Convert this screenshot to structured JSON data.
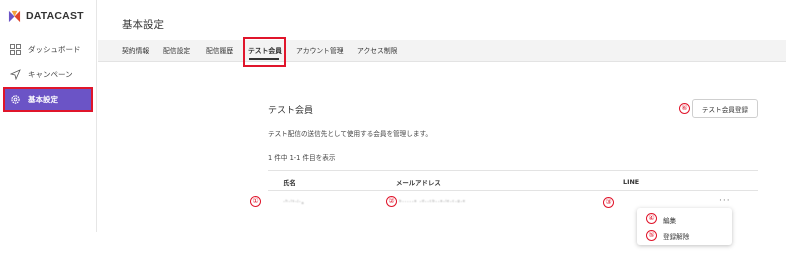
{
  "app": {
    "logo_text": "DATACAST"
  },
  "sidebar": {
    "items": [
      {
        "label": "ダッシュボード",
        "icon": "dashboard-icon"
      },
      {
        "label": "キャンペーン",
        "icon": "send-icon"
      },
      {
        "label": "基本設定",
        "icon": "gear-icon",
        "active": true
      }
    ]
  },
  "header": {
    "title": "基本設定"
  },
  "tabs": [
    {
      "label": "契約情報"
    },
    {
      "label": "配信設定"
    },
    {
      "label": "配信履歴"
    },
    {
      "label": "テスト会員",
      "active": true
    },
    {
      "label": "アカウント管理"
    },
    {
      "label": "アクセス制限"
    }
  ],
  "main": {
    "section_title": "テスト会員",
    "description": "テスト配信の送信先として使用する会員を管理します。",
    "count_text": "1 件中 1-1 件目を表示",
    "register_button": "テスト会員登録",
    "table": {
      "headers": [
        "氏名",
        "メールアドレス",
        "LINE"
      ],
      "rows": [
        {
          "name": "·ʰ·ˡˢ·ʲ·ₐ",
          "email": "ᵇ·····ᵃ ·ᵈ··ᶜᵇ··ᵃ·ˡᵉ·ᶜ·ᵍ·ᵉ",
          "more": "···"
        }
      ]
    },
    "row_menu": [
      {
        "label": "編集"
      },
      {
        "label": "登録解除"
      }
    ]
  },
  "annotations": {
    "markers": [
      "①",
      "②",
      "③",
      "④",
      "⑤",
      "⑥"
    ],
    "highlight_color": "#e0152b"
  },
  "colors": {
    "accent": "#6b54c6",
    "highlight": "#e0152b"
  }
}
